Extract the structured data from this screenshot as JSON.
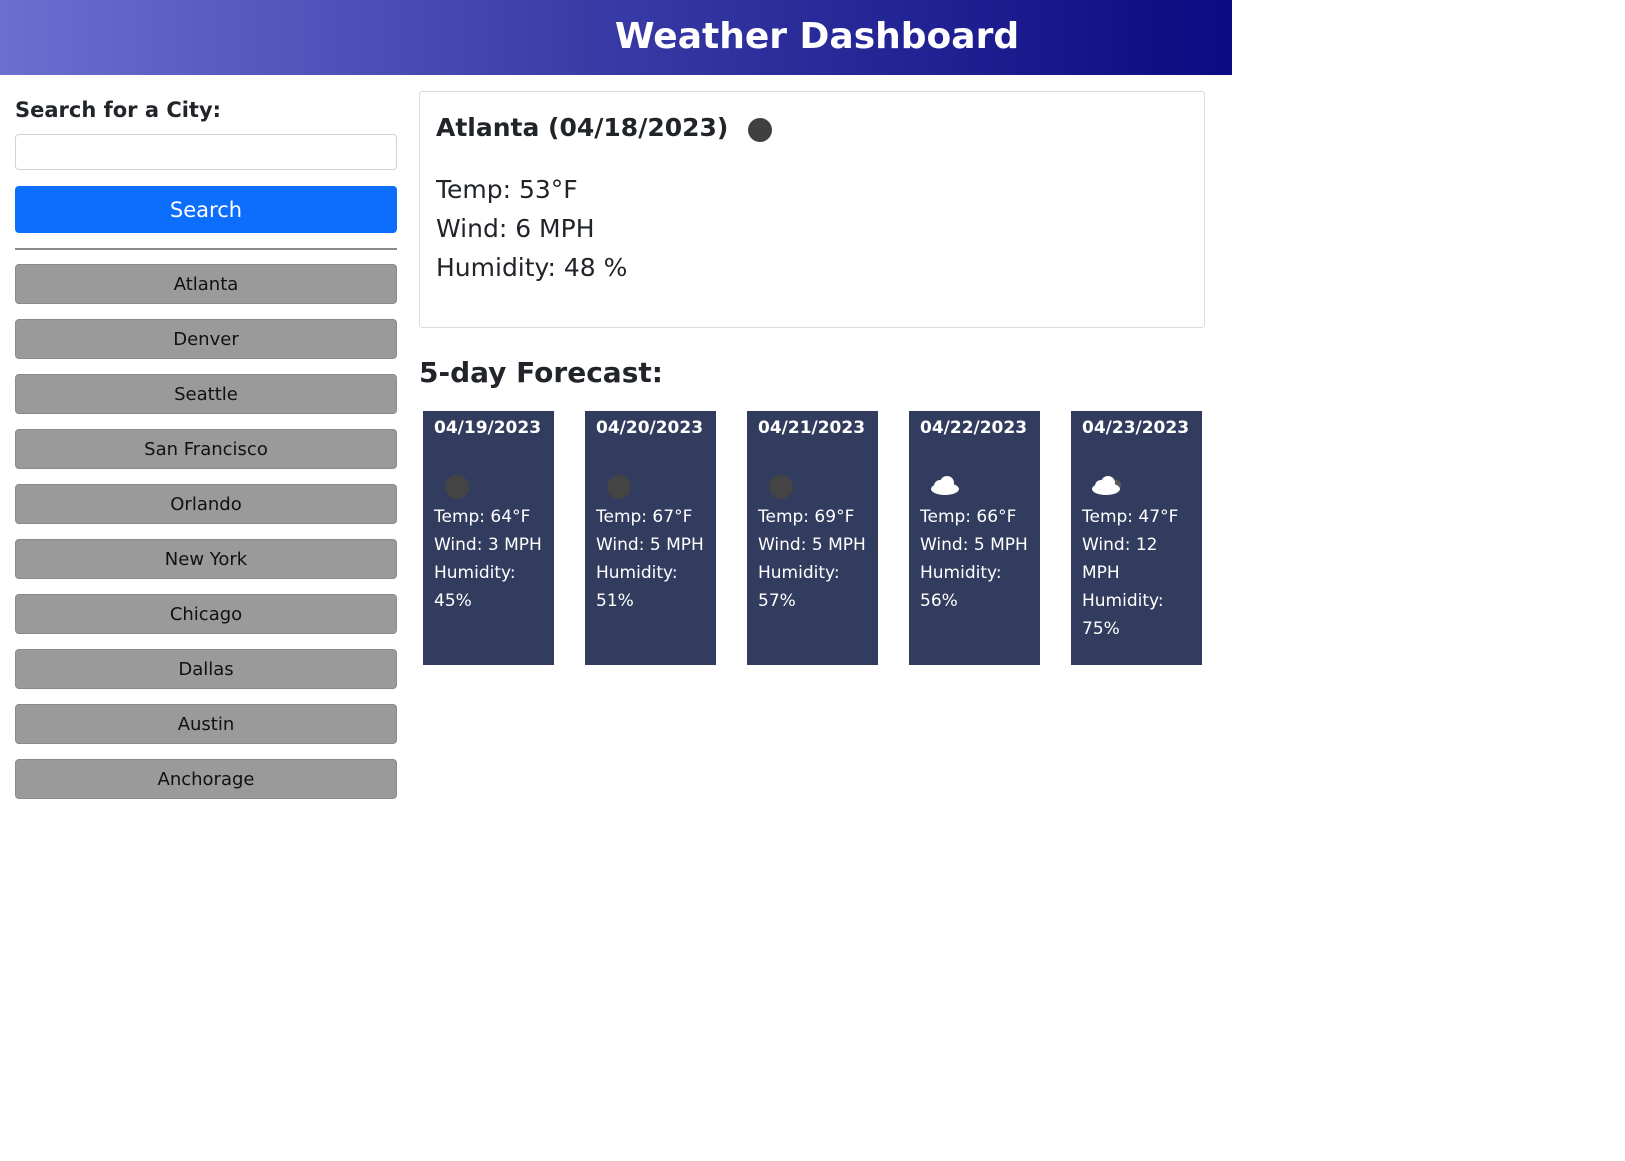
{
  "header": {
    "title": "Weather Dashboard"
  },
  "colors": {
    "header_start": "#6b6fd0",
    "header_end": "#0b0a82",
    "search_button": "#0d6efd",
    "history_button": "#9a9a9a",
    "forecast_card": "#323c5e"
  },
  "sidebar": {
    "search_label": "Search for a City:",
    "search_value": "",
    "search_placeholder": "",
    "search_button_label": "Search",
    "history": [
      "Atlanta",
      "Denver",
      "Seattle",
      "San Francisco",
      "Orlando",
      "New York",
      "Chicago",
      "Dallas",
      "Austin",
      "Anchorage"
    ]
  },
  "current": {
    "title": "Atlanta (04/18/2023)",
    "icon": "dark-circle-icon",
    "temp": "Temp: 53°F",
    "wind": "Wind: 6 MPH",
    "humidity": "Humidity: 48 %"
  },
  "forecast": {
    "heading": "5-day Forecast:",
    "days": [
      {
        "date": "04/19/2023",
        "icon": "dark-circle-icon",
        "temp": "Temp: 64°F",
        "wind": "Wind: 3 MPH",
        "humidity": "Humidity: 45%"
      },
      {
        "date": "04/20/2023",
        "icon": "dark-circle-icon",
        "temp": "Temp: 67°F",
        "wind": "Wind: 5 MPH",
        "humidity": "Humidity: 51%"
      },
      {
        "date": "04/21/2023",
        "icon": "dark-circle-icon",
        "temp": "Temp: 69°F",
        "wind": "Wind: 5 MPH",
        "humidity": "Humidity: 57%"
      },
      {
        "date": "04/22/2023",
        "icon": "cloud-icon",
        "temp": "Temp: 66°F",
        "wind": "Wind: 5 MPH",
        "humidity": "Humidity: 56%"
      },
      {
        "date": "04/23/2023",
        "icon": "cloud-icon",
        "temp": "Temp: 47°F",
        "wind": "Wind: 12 MPH",
        "humidity": "Humidity: 75%"
      }
    ]
  }
}
